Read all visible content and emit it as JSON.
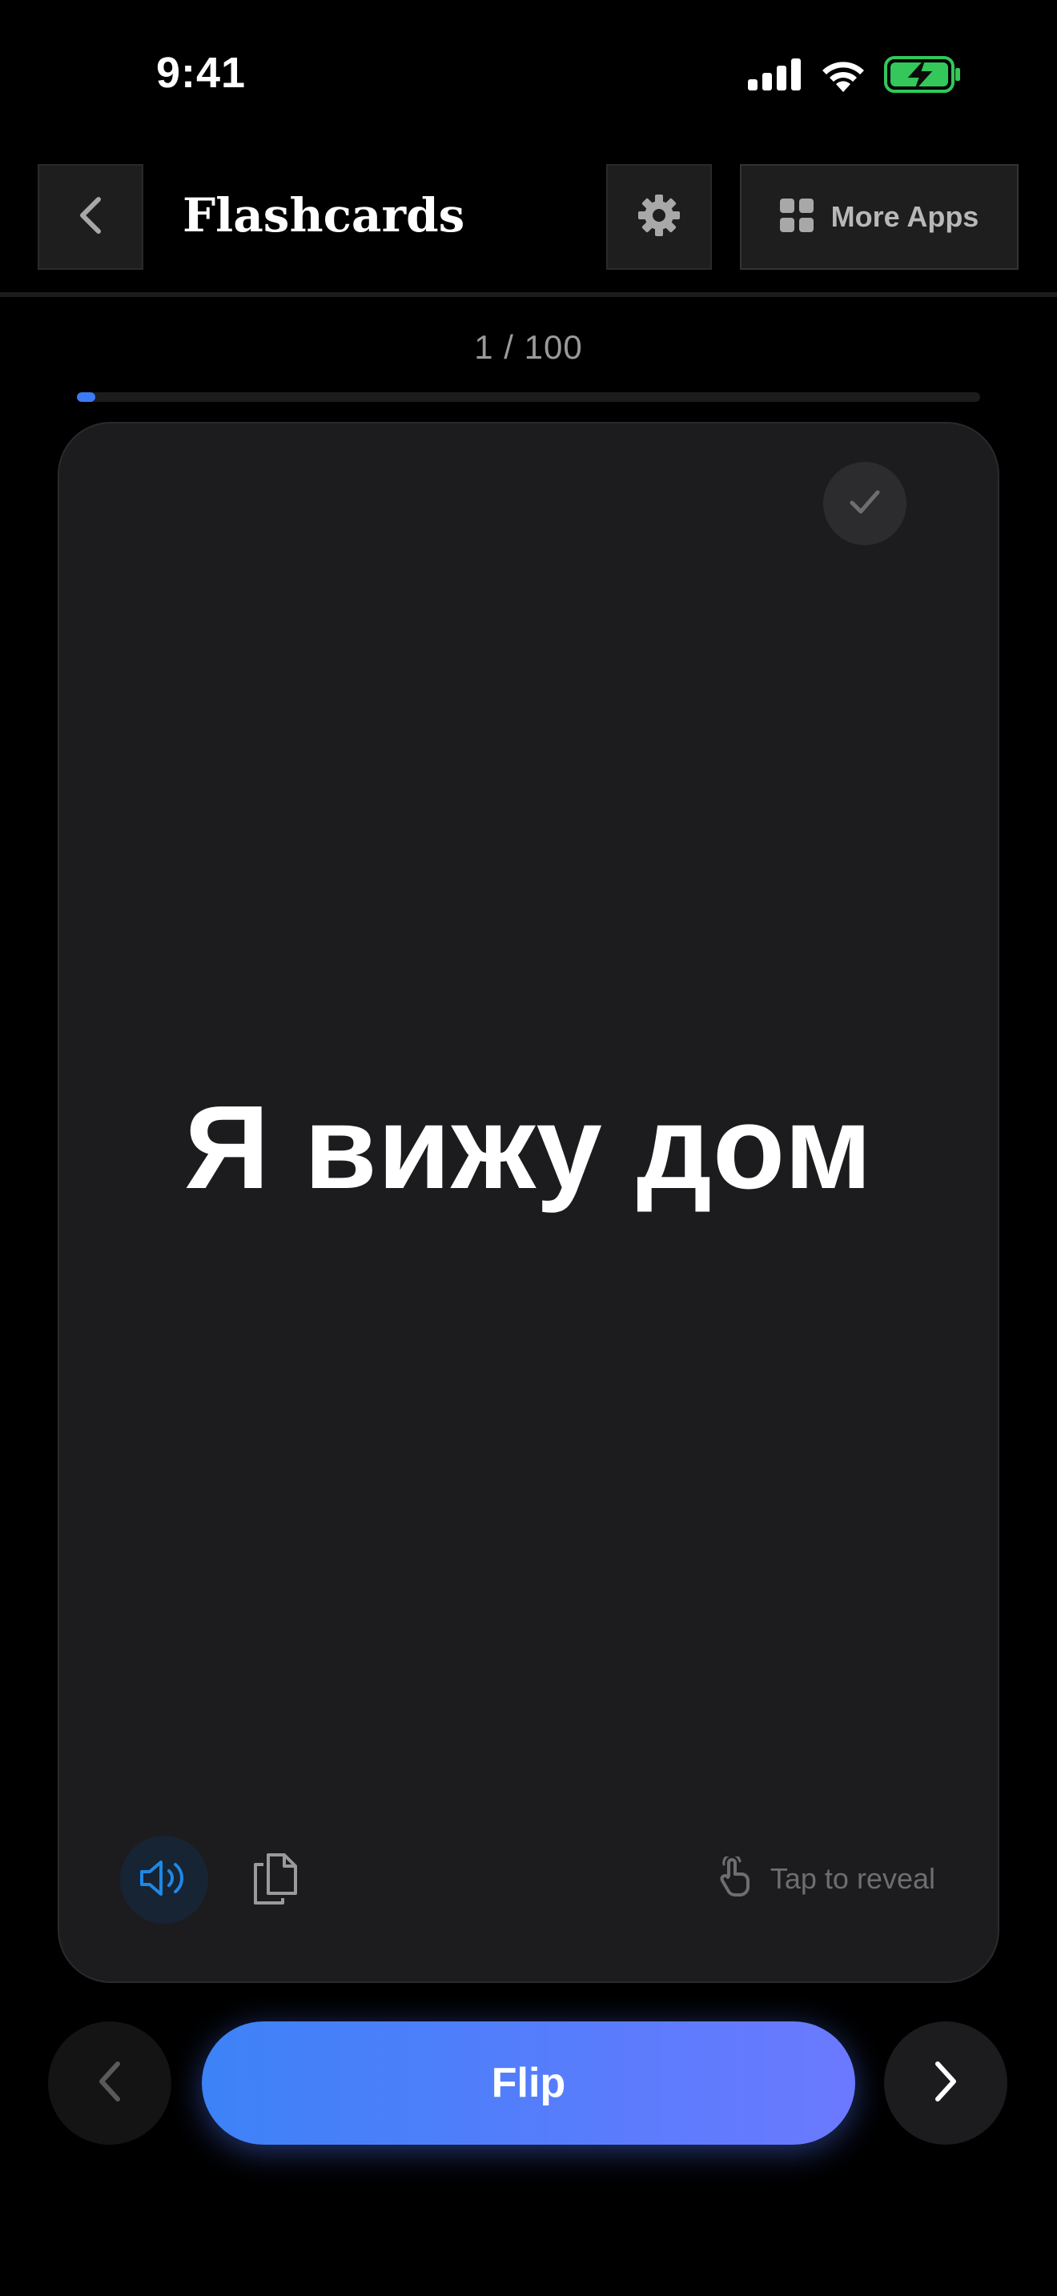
{
  "status_bar": {
    "time": "9:41",
    "icons": [
      "cellular-signal-icon",
      "wifi-icon",
      "battery-charging-icon"
    ],
    "battery_color": "#34c759"
  },
  "header": {
    "back_icon": "chevron-left-icon",
    "title": "Flashcards",
    "settings_icon": "gear-icon",
    "more_apps_icon": "grid-icon",
    "more_apps_label": "More Apps"
  },
  "progress": {
    "label": "1 / 100",
    "current": 1,
    "total": 100,
    "fill_color": "#3d7bf5"
  },
  "card": {
    "text": "Я вижу дом",
    "check_icon": "checkmark-icon",
    "audio_icon": "speaker-icon",
    "audio_accent": "#1e88e5",
    "copy_icon": "copy-icon",
    "tap_icon": "tap-hand-icon",
    "tap_label": "Tap to reveal"
  },
  "footer": {
    "prev_icon": "chevron-left-icon",
    "flip_label": "Flip",
    "next_icon": "chevron-right-icon",
    "accent_gradient": [
      "#3d82f7",
      "#6b79ff"
    ]
  }
}
